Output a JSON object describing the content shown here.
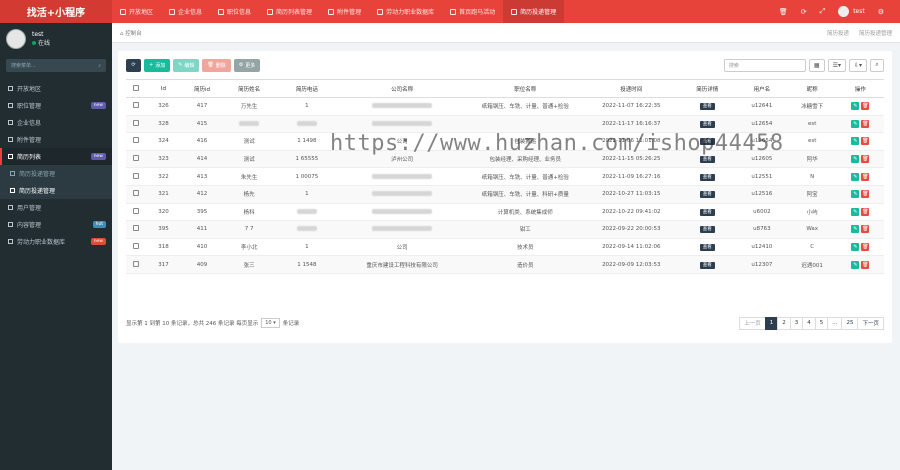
{
  "app": {
    "brand": "找活+小程序"
  },
  "topnav": [
    {
      "label": "开放地区"
    },
    {
      "label": "企业信息"
    },
    {
      "label": "职位信息"
    },
    {
      "label": "简历列表管理"
    },
    {
      "label": "附件管理"
    },
    {
      "label": "劳动力职业数据库"
    },
    {
      "label": "首页跑马活动"
    },
    {
      "label": "简历投递管理",
      "active": true
    }
  ],
  "topright": {
    "username": "test"
  },
  "sidebar": {
    "username": "test",
    "status": "在线",
    "search_placeholder": "搜索菜单...",
    "items": [
      {
        "label": "开放地区"
      },
      {
        "label": "职位管理",
        "badge": "new",
        "badge_color": "#605ca8"
      },
      {
        "label": "企业信息"
      },
      {
        "label": "附件管理"
      },
      {
        "label": "简历列表",
        "badge": "new",
        "badge_color": "#605ca8",
        "open": true
      },
      {
        "label": "简历投递管理",
        "sub": true
      },
      {
        "label": "简历投递管理",
        "sub": true,
        "active": true
      },
      {
        "label": "用户管理"
      },
      {
        "label": "内容管理",
        "badge": "hot",
        "badge_color": "#3c8dbc"
      },
      {
        "label": "劳动力职业数据库",
        "badge": "new",
        "badge_color": "#dd4b39"
      }
    ]
  },
  "breadcrumb": {
    "left": "控制台",
    "right1": "简历投递",
    "right2": "简历投递管理"
  },
  "toolbar": {
    "add": "添加",
    "edit": "编辑",
    "delete": "删除",
    "more": "更多",
    "search_placeholder": "搜索"
  },
  "table": {
    "headers": [
      "Id",
      "简历id",
      "简历姓名",
      "简历电话",
      "公司名称",
      "职位名称",
      "投递时间",
      "简历详情",
      "用户名",
      "昵称",
      "操作"
    ],
    "view_label": "查看",
    "rows": [
      {
        "id": "326",
        "rid": "417",
        "name": "万先生",
        "phone": "1",
        "company": "",
        "position": "纸箱钢压、车铣、计量、普通+检验",
        "time": "2022-11-07 16:22:35",
        "user": "u12641",
        "nick": "冰糖雪下"
      },
      {
        "id": "328",
        "rid": "415",
        "name": "",
        "phone": "",
        "company": "",
        "position": "",
        "time": "2022-11-17 16:16:37",
        "user": "u12654",
        "nick": "est"
      },
      {
        "id": "324",
        "rid": "416",
        "name": "测试",
        "phone": "1 1498",
        "company": "公司",
        "position": "包装搬运",
        "time": "2022-11-06 11:01:08",
        "user": "u12654",
        "nick": "est"
      },
      {
        "id": "323",
        "rid": "414",
        "name": "测试",
        "phone": "1 65555",
        "company": "泸州公司",
        "position": "包装经理、采购经理、业务员",
        "time": "2022-11-15 05:26:25",
        "user": "u12605",
        "nick": "阿华"
      },
      {
        "id": "322",
        "rid": "413",
        "name": "朱先生",
        "phone": "1 00075",
        "company": "",
        "position": "纸箱钢压、车铣、计量、普通+检验",
        "time": "2022-11-09 16:27:16",
        "user": "u12551",
        "nick": "N"
      },
      {
        "id": "321",
        "rid": "412",
        "name": "杨先",
        "phone": "1",
        "company": "",
        "position": "纸箱钢压、车铣、计量、科研+质量",
        "time": "2022-10-27 11:03:15",
        "user": "u12516",
        "nick": "阿宝"
      },
      {
        "id": "320",
        "rid": "395",
        "name": "杨科",
        "phone": "",
        "company": "",
        "position": "计算机类、系统集成师",
        "time": "2022-10-22 09:41:02",
        "user": "u6002",
        "nick": "小屿"
      },
      {
        "id": "395",
        "rid": "411",
        "name": "7 7",
        "phone": "",
        "company": "",
        "position": "钳工",
        "time": "2022-09-22 20:00:53",
        "user": "u8763",
        "nick": "Wax"
      },
      {
        "id": "318",
        "rid": "410",
        "name": "李小北",
        "phone": "1",
        "company": "公司",
        "position": "技术员",
        "time": "2022-09-14 11:02:06",
        "user": "u12410",
        "nick": "C"
      },
      {
        "id": "317",
        "rid": "409",
        "name": "张三",
        "phone": "1 1548",
        "company": "重庆市建设工程科技有限公司",
        "position": "造价员",
        "time": "2022-09-09 12:03:53",
        "user": "u12307",
        "nick": "迟遇001"
      }
    ]
  },
  "footer": {
    "summary": "显示第 1 到第 10 条记录，总共 246 条记录 每页显示",
    "page_size": "10",
    "suffix": "条记录",
    "prev": "上一页",
    "pages": [
      "1",
      "2",
      "3",
      "4",
      "5",
      "...",
      "25"
    ],
    "next": "下一页"
  },
  "watermark": "https://www.huzhan.com/ishop44458"
}
